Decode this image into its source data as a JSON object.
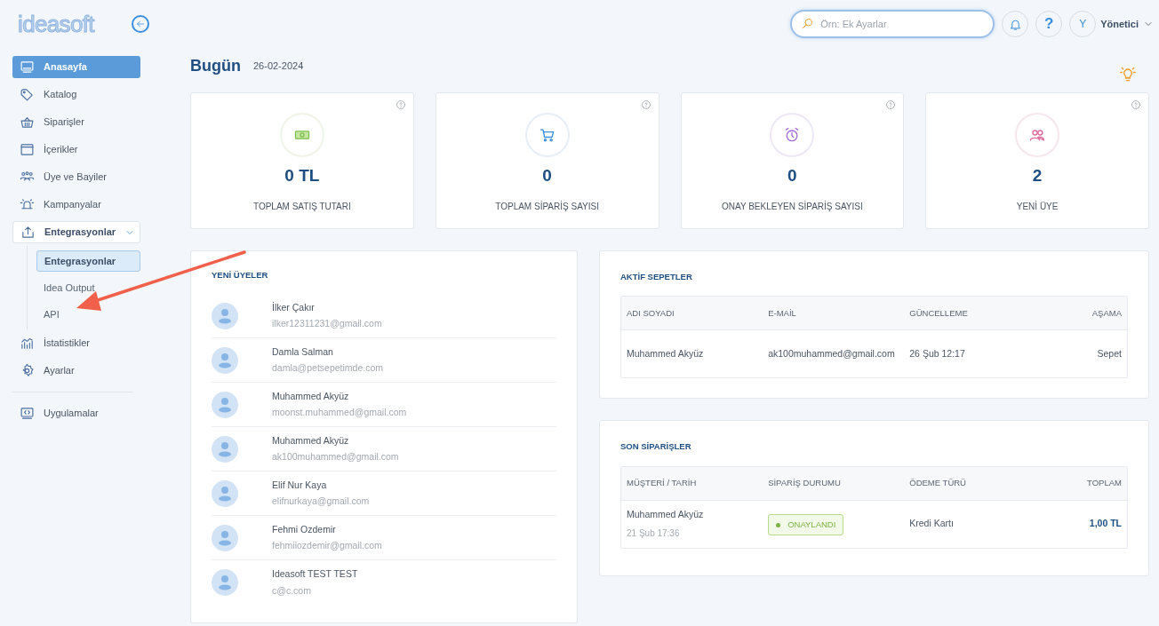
{
  "logo": "ideasoft",
  "search": {
    "placeholder": "Örn: Ek Ayarlar"
  },
  "help_label": "?",
  "user": {
    "initial": "Y",
    "name": "Yönetici"
  },
  "sidebar": {
    "items": [
      {
        "label": "Anasayfa",
        "selected": true
      },
      {
        "label": "Katalog",
        "selected": false
      },
      {
        "label": "Siparişler",
        "selected": false
      },
      {
        "label": "İçerikler",
        "selected": false
      },
      {
        "label": "Üye ve Bayiler",
        "selected": false
      },
      {
        "label": "Kampanyalar",
        "selected": false
      },
      {
        "label": "Entegrasyonlar",
        "selected": false,
        "expanded": true,
        "children": [
          {
            "label": "Entegrasyonlar",
            "selected": true
          },
          {
            "label": "Idea Output",
            "selected": false
          },
          {
            "label": "API",
            "selected": false
          }
        ]
      },
      {
        "label": "İstatistikler",
        "selected": false
      },
      {
        "label": "Ayarlar",
        "selected": false
      },
      {
        "label": "Uygulamalar",
        "selected": false
      }
    ]
  },
  "page": {
    "title": "Bugün",
    "date": "26-02-2024"
  },
  "stats": [
    {
      "value": "0 TL",
      "label": "TOPLAM SATIŞ TUTARI"
    },
    {
      "value": "0",
      "label": "TOPLAM SİPARİŞ SAYISI"
    },
    {
      "value": "0",
      "label": "ONAY BEKLEYEN SİPARİŞ SAYISI"
    },
    {
      "value": "2",
      "label": "YENİ ÜYE"
    }
  ],
  "new_members": {
    "title": "YENİ ÜYELER",
    "items": [
      {
        "name": "İlker Çakır",
        "email": "ilker12311231@gmail.com"
      },
      {
        "name": "Damla Salman",
        "email": "damla@petsepetimde.com"
      },
      {
        "name": "Muhammed Akyüz",
        "email": "moonst.muhammed@gmail.com"
      },
      {
        "name": "Muhammed Akyüz",
        "email": "ak100muhammed@gmail.com"
      },
      {
        "name": "Elif Nur Kaya",
        "email": "elifnurkaya@gmail.com"
      },
      {
        "name": "Fehmi Ozdemir",
        "email": "fehmiiozdemir@gmail.com"
      },
      {
        "name": "Ideasoft TEST TEST",
        "email": "c@c.com"
      }
    ]
  },
  "active_carts": {
    "title": "AKTİF SEPETLER",
    "columns": [
      "ADI SOYADI",
      "E-MAİL",
      "GÜNCELLEME",
      "AŞAMA"
    ],
    "rows": [
      [
        "Muhammed Akyüz",
        "ak100muhammed@gmail.com",
        "26 Şub 12:17",
        "Sepet"
      ]
    ]
  },
  "recent_orders": {
    "title": "SON SİPARİŞLER",
    "columns": [
      "MÜŞTERİ / TARİH",
      "SİPARİŞ DURUMU",
      "ÖDEME TÜRÜ",
      "TOPLAM"
    ],
    "rows": [
      {
        "customer": "Muhammed Akyüz",
        "date": "21 Şub 17:36",
        "status": {
          "text": "ONAYLANDI",
          "kind": "approved"
        },
        "payment": "Kredi Kartı",
        "total": "1,00 TL"
      }
    ]
  }
}
